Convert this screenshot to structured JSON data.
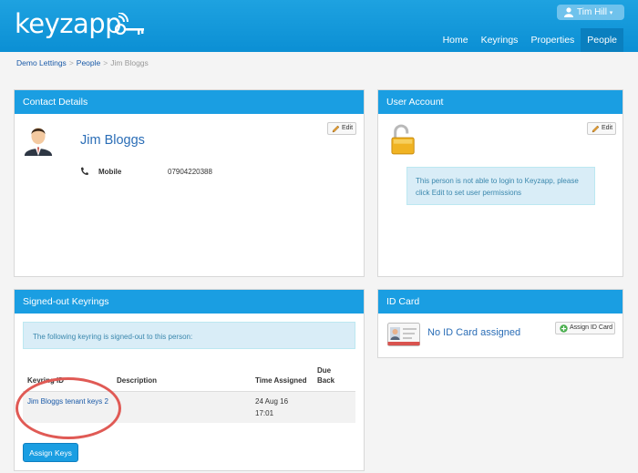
{
  "app": {
    "logo_text": "keyzapp"
  },
  "header": {
    "user_name": "Tim Hill",
    "nav": [
      {
        "label": "Home"
      },
      {
        "label": "Keyrings"
      },
      {
        "label": "Properties"
      },
      {
        "label": "People",
        "active": true
      }
    ]
  },
  "breadcrumb": {
    "items": [
      "Demo Lettings",
      "People",
      "Jim Bloggs"
    ],
    "separator": ">"
  },
  "contact": {
    "title": "Contact Details",
    "name": "Jim Bloggs",
    "mobile_label": "Mobile",
    "mobile_value": "07904220388",
    "edit_label": "Edit"
  },
  "account": {
    "title": "User Account",
    "edit_label": "Edit",
    "message": "This person is not able to login to Keyzapp, please click Edit to set user permissions"
  },
  "keyrings": {
    "title": "Signed-out Keyrings",
    "message": "The following keyring is signed-out to this person:",
    "columns": [
      "Keyring ID",
      "Description",
      "Time Assigned",
      "Due Back"
    ],
    "rows": [
      {
        "keyring_id": "Jim Bloggs tenant keys 2",
        "description": "",
        "time_assigned": "24 Aug 16 17:01",
        "due_back": ""
      }
    ],
    "assign_button": "Assign Keys"
  },
  "idcard": {
    "title": "ID Card",
    "status": "No ID Card assigned",
    "assign_button": "Assign ID Card"
  },
  "colors": {
    "brand_blue": "#1a9ee2",
    "annotation_red": "#e05a55"
  }
}
